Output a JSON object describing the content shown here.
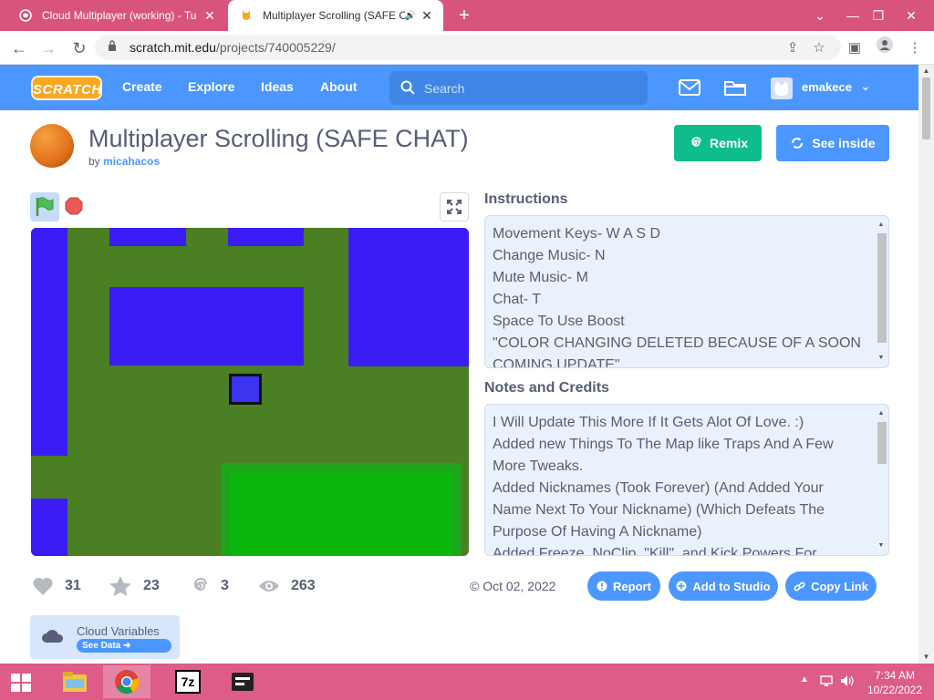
{
  "browser": {
    "tabs": [
      {
        "title": "Cloud Multiplayer (working) - Tu",
        "active": false
      },
      {
        "title": "Multiplayer Scrolling (SAFE C",
        "active": true
      }
    ],
    "url_domain": "scratch.mit.edu",
    "url_path": "/projects/740005229/",
    "colors": {
      "tabstrip": "#d9547d",
      "taskbar": "#dd5c89"
    }
  },
  "nav": {
    "logo": "SCRATCH",
    "links": [
      "Create",
      "Explore",
      "Ideas",
      "About"
    ],
    "search_placeholder": "Search",
    "username": "emakece",
    "accent": "#4c97ff"
  },
  "project": {
    "title": "Multiplayer Scrolling (SAFE CHAT)",
    "by_prefix": "by",
    "author": "micahacos",
    "remix_label": "Remix",
    "see_inside_label": "See inside"
  },
  "instructions": {
    "heading": "Instructions",
    "lines": [
      "Movement Keys- W A S D",
      "Change Music- N",
      "Mute Music- M",
      "Chat- T",
      "Space To Use Boost",
      "\"COLOR CHANGING DELETED BECAUSE OF A SOON",
      "COMING UPDATE\""
    ]
  },
  "notes": {
    "heading": "Notes and Credits",
    "lines": [
      "I Will Update This More If It Gets Alot Of Love. :)",
      "Added new Things To The Map like Traps And A Few",
      "More Tweaks.",
      "Added Nicknames (Took Forever) (And Added Your",
      "Name Next To Your Nickname) (Which Defeats The",
      "Purpose Of Having A Nickname)",
      "Added Freeze, NoClip, \"Kill\", and Kick Powers For"
    ]
  },
  "stats": {
    "loves": "31",
    "favorites": "23",
    "remixes": "3",
    "views": "263"
  },
  "shared_date": "© Oct 02, 2022",
  "actions": {
    "report": "Report",
    "add_to_studio": "Add to Studio",
    "copy_link": "Copy Link"
  },
  "cloud": {
    "label": "Cloud Variables",
    "see_data": "See Data"
  },
  "taskbar": {
    "time": "7:34 AM",
    "date": "10/22/2022"
  }
}
